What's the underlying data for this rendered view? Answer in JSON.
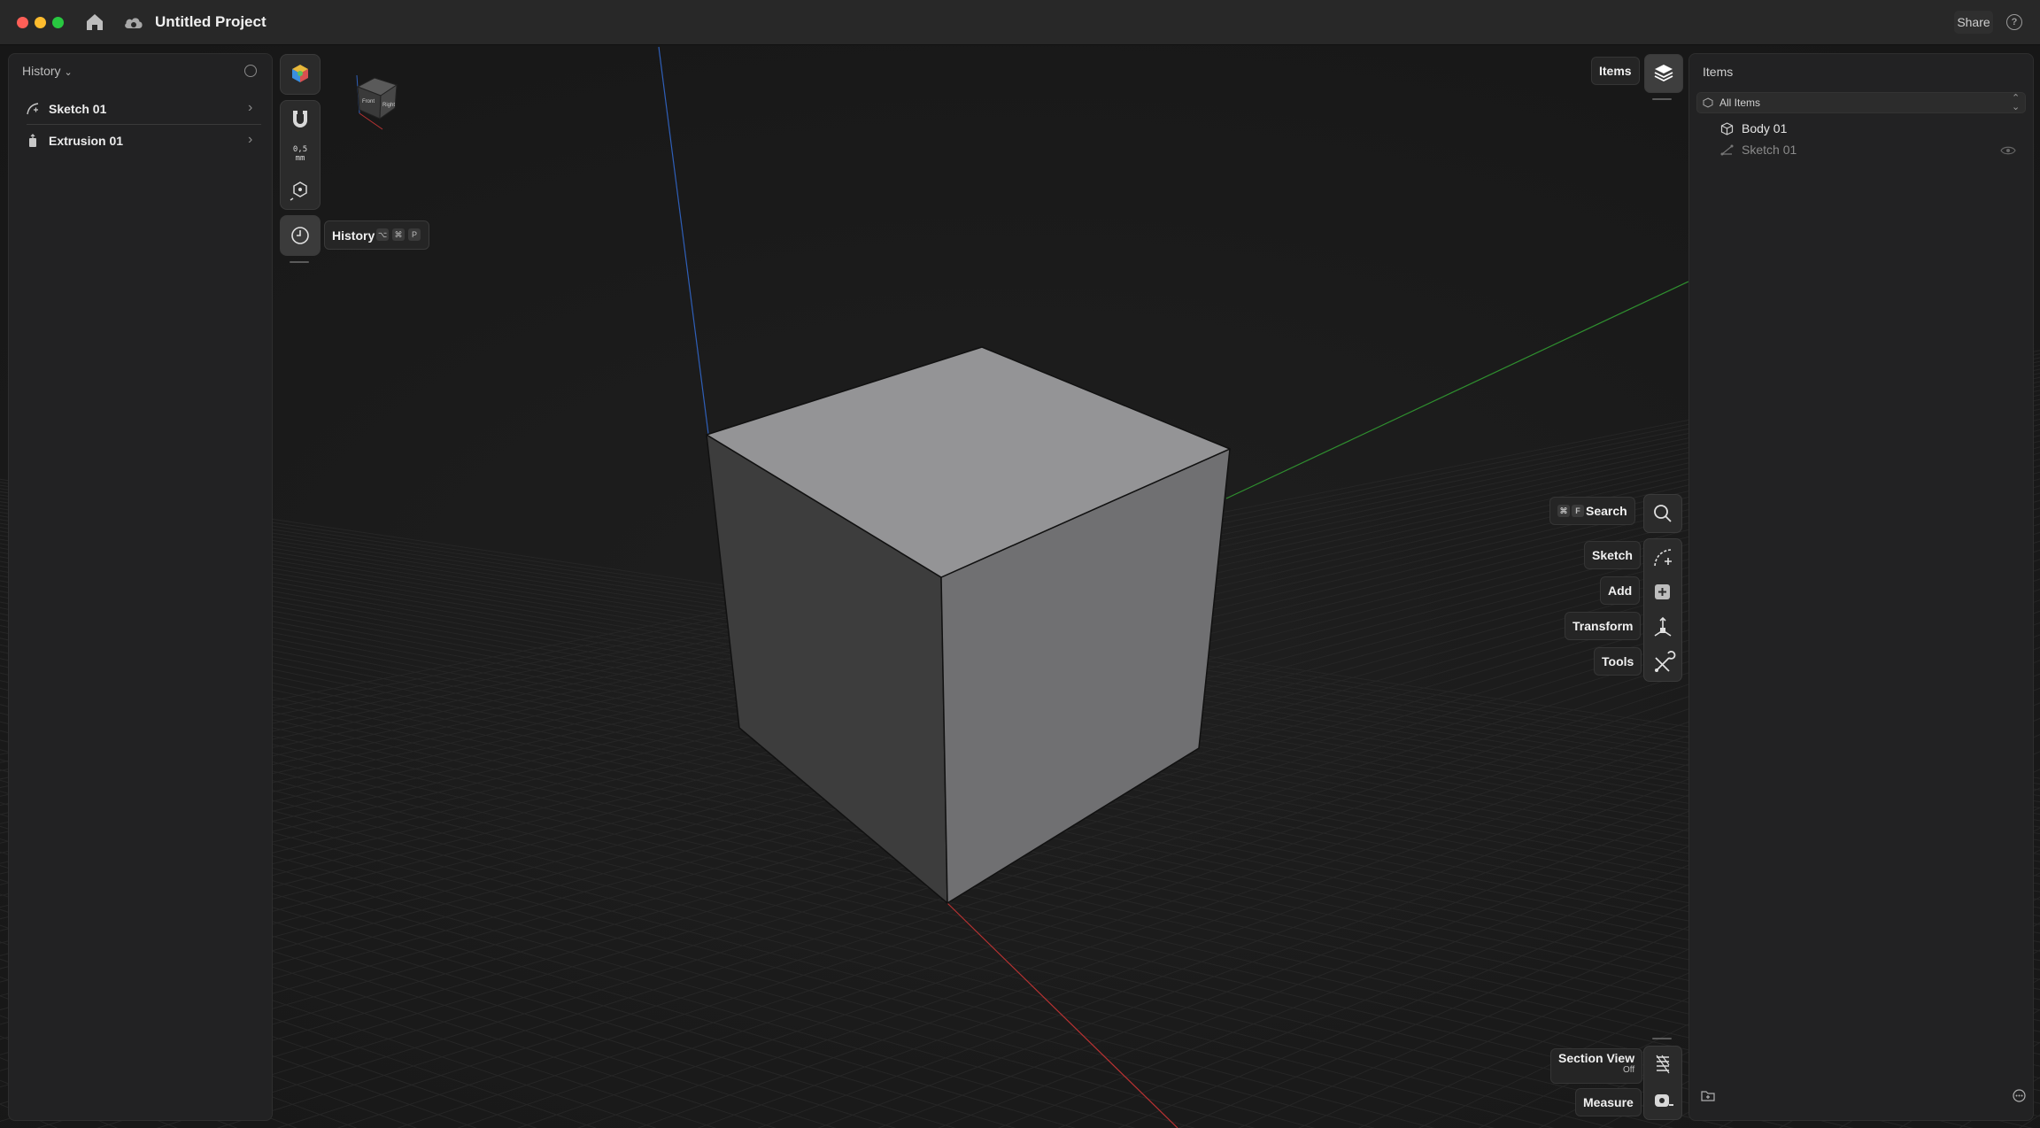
{
  "window": {
    "title": "Untitled Project",
    "share_label": "Share",
    "help_label": "?"
  },
  "history_panel": {
    "title": "History",
    "items": [
      {
        "label": "Sketch 01",
        "icon": "sketch-icon"
      },
      {
        "label": "Extrusion 01",
        "icon": "extrusion-icon"
      }
    ]
  },
  "left_tools": {
    "snap_value": "0,5",
    "snap_unit": "mm",
    "tooltip": {
      "label": "History",
      "keys": [
        "⌥",
        "⌘",
        "P"
      ]
    }
  },
  "right_tools": {
    "items_label": "Items",
    "search_label": "Search",
    "search_keys": [
      "⌘",
      "F"
    ],
    "sketch_label": "Sketch",
    "add_label": "Add",
    "transform_label": "Transform",
    "tools_label": "Tools",
    "section_view_label": "Section View",
    "section_view_state": "Off",
    "measure_label": "Measure"
  },
  "items_panel": {
    "title": "Items",
    "filter_label": "All Items",
    "items": [
      {
        "label": "Body 01",
        "icon": "body-icon"
      },
      {
        "label": "Sketch 01",
        "icon": "sketch-item-icon"
      }
    ]
  },
  "colors": {
    "background": "#1b1b1b",
    "panel": "#222223",
    "cube_top": "#949496",
    "cube_left": "#3d3d3d",
    "cube_right": "#707072",
    "axis_x": "#b83232",
    "axis_y": "#2f8f2f",
    "axis_z": "#2f5fb8"
  }
}
